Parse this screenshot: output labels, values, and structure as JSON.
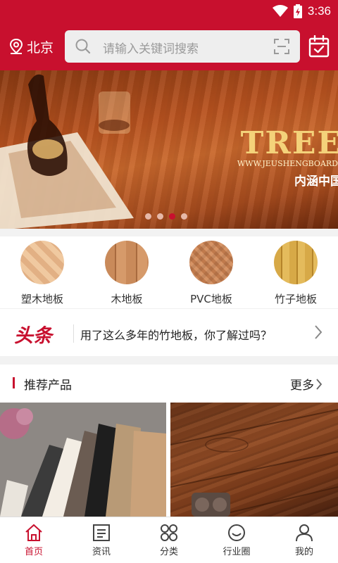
{
  "status_bar": {
    "time": "3:36"
  },
  "header": {
    "city": "北京",
    "search_placeholder": "请输入关键词搜索"
  },
  "banner": {
    "brand": "TREE",
    "url": "WWW.JEUSHENGBOARD",
    "slogan": "内涵中国",
    "dots": 4,
    "active_dot": 2
  },
  "categories": [
    {
      "label": "塑木地板"
    },
    {
      "label": "木地板"
    },
    {
      "label": "PVC地板"
    },
    {
      "label": "竹子地板"
    }
  ],
  "news": {
    "tag": "头条",
    "headline": "用了这么多年的竹地板，你了解过吗？"
  },
  "recommended": {
    "title": "推荐产品",
    "more": "更多"
  },
  "tabbar": {
    "items": [
      {
        "label": "首页",
        "active": true
      },
      {
        "label": "资讯",
        "active": false
      },
      {
        "label": "分类",
        "active": false
      },
      {
        "label": "行业圈",
        "active": false
      },
      {
        "label": "我的",
        "active": false
      }
    ]
  },
  "colors": {
    "brand_red": "#c8102e"
  }
}
